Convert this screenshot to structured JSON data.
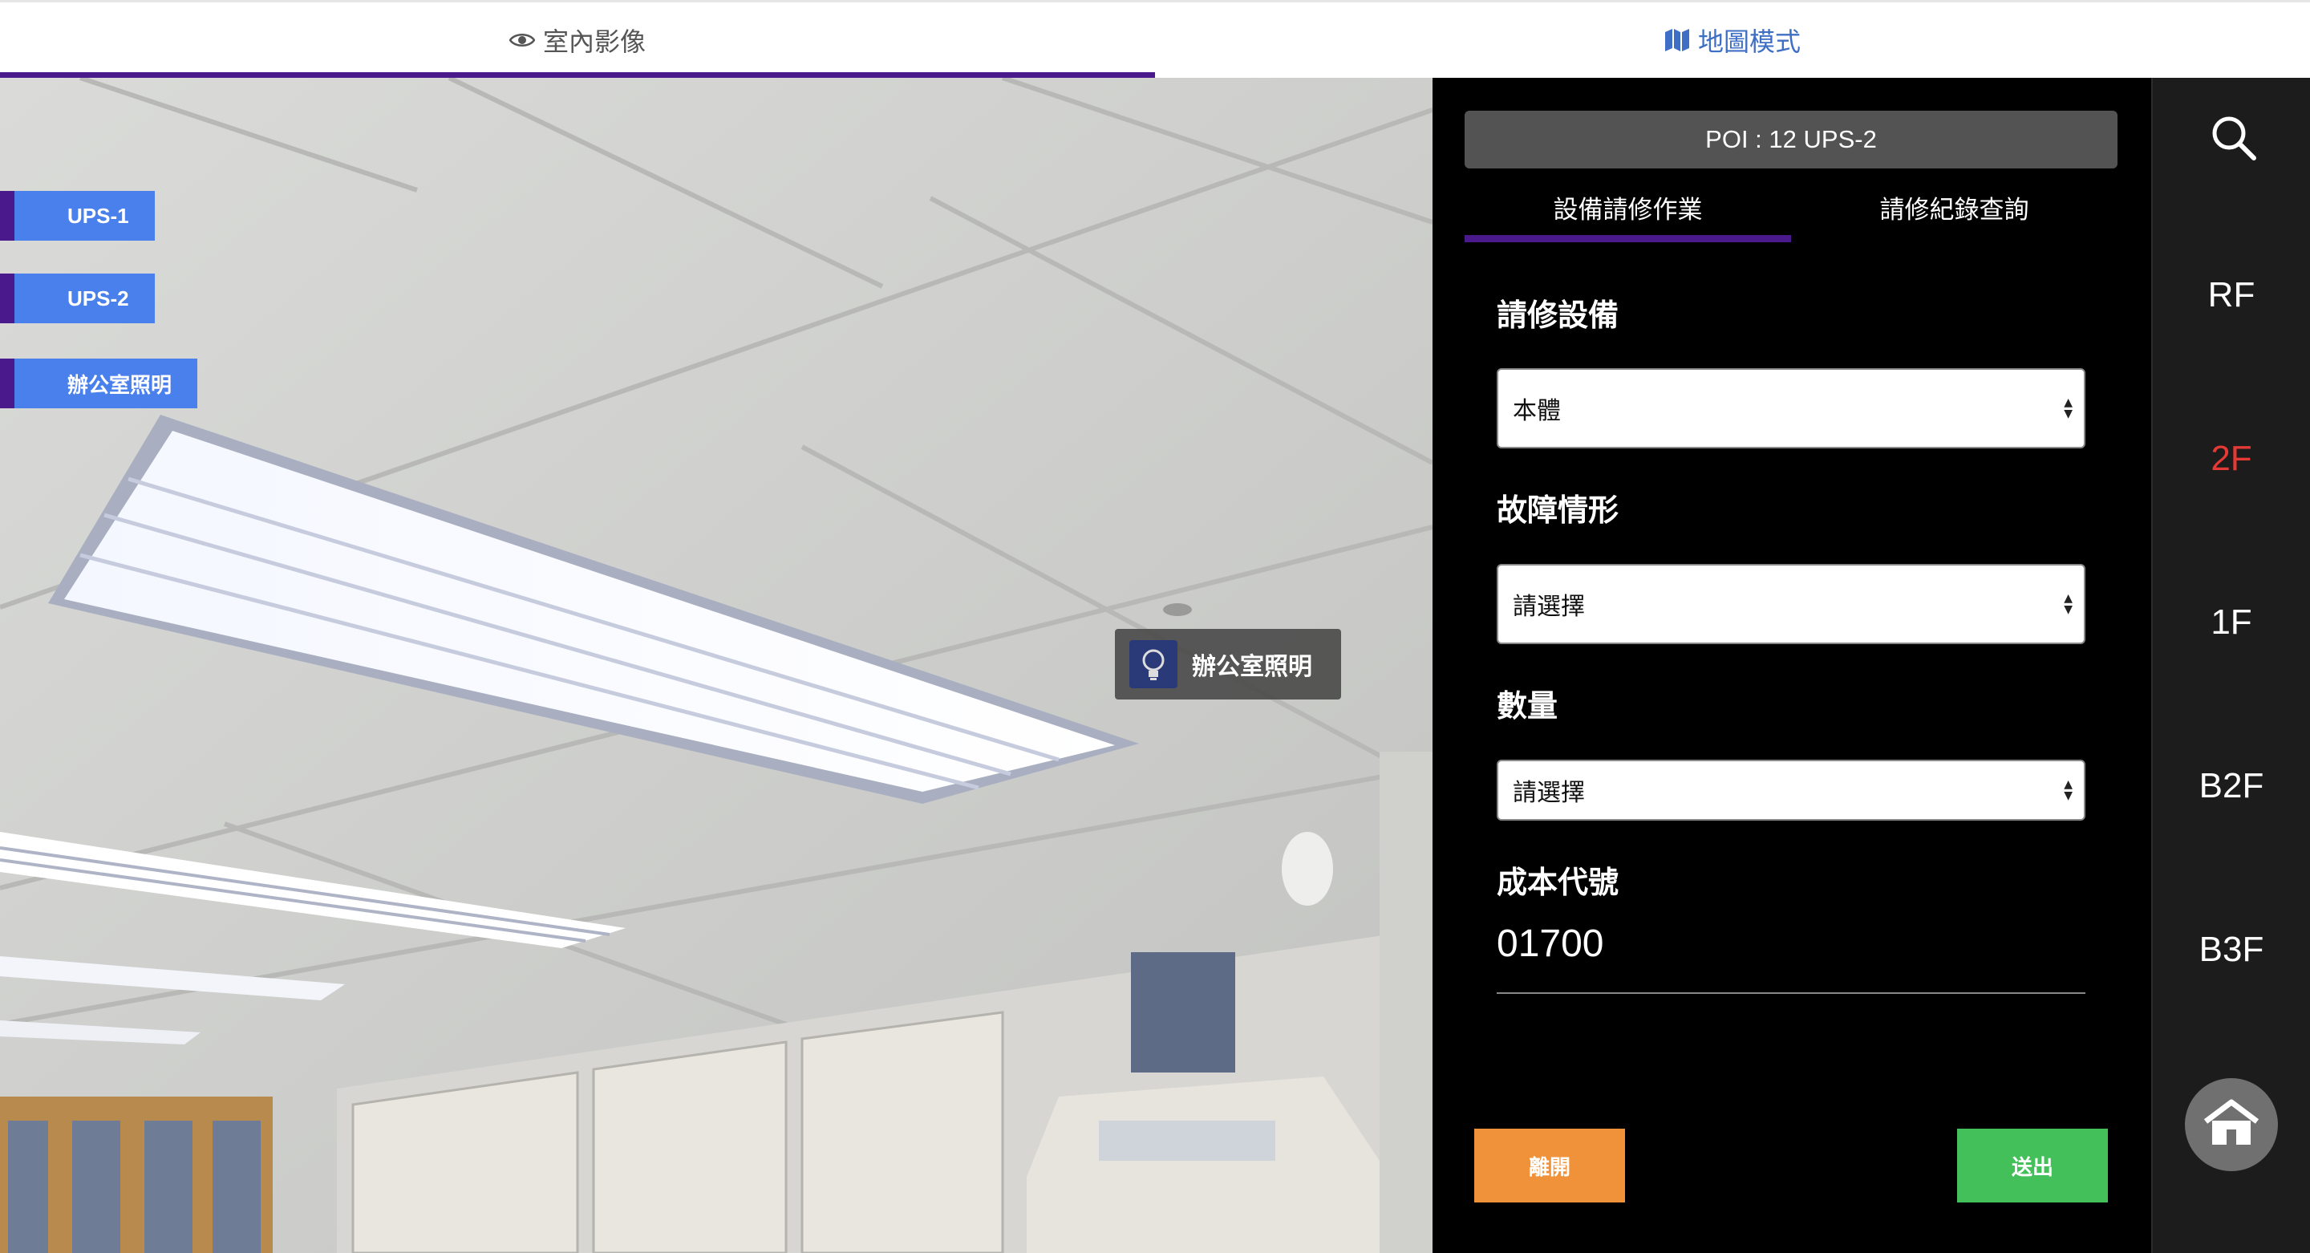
{
  "top_tabs": [
    {
      "label": "室內影像",
      "icon": "eye-icon",
      "active": true
    },
    {
      "label": "地圖模式",
      "icon": "map-icon",
      "active": false
    }
  ],
  "viewer": {
    "poi_chips": [
      "UPS-1",
      "UPS-2",
      "辦公室照明"
    ],
    "hotspot": {
      "label": "辦公室照明",
      "icon": "lightbulb-icon"
    }
  },
  "panel": {
    "poi_header": "POI : 12 UPS-2",
    "tabs": [
      {
        "label": "設備請修作業",
        "active": true
      },
      {
        "label": "請修紀錄查詢",
        "active": false
      }
    ],
    "fields": {
      "equipment": {
        "label": "請修設備",
        "value": "本體"
      },
      "fault": {
        "label": "故障情形",
        "value": "請選擇"
      },
      "quantity": {
        "label": "數量",
        "value": "請選擇"
      },
      "cost_code": {
        "label": "成本代號",
        "value": "01700"
      }
    },
    "buttons": {
      "leave": "離開",
      "send": "送出"
    }
  },
  "floors": {
    "items": [
      "RF",
      "2F",
      "1F",
      "B2F",
      "B3F"
    ],
    "active": "2F",
    "search_icon": "search-icon",
    "home_icon": "home-icon"
  },
  "colors": {
    "accent_purple": "#4a1a8c",
    "poi_blue": "#4a80ec",
    "active_floor": "#e53935",
    "leave_orange": "#f0923a",
    "send_green": "#44c05a",
    "map_tab_blue": "#3f6fc4"
  }
}
